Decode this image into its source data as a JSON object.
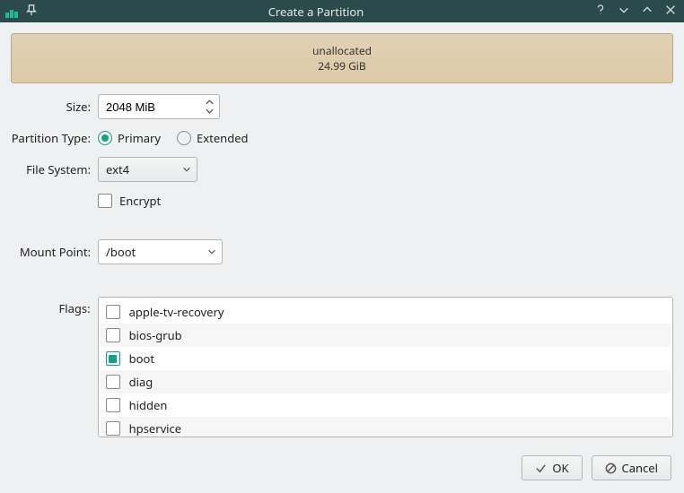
{
  "window": {
    "title": "Create a Partition"
  },
  "partition_bar": {
    "name": "unallocated",
    "size": "24.99 GiB"
  },
  "form": {
    "size": {
      "label": "Size:",
      "value": "2048 MiB"
    },
    "partition_type": {
      "label": "Partition Type:",
      "primary": "Primary",
      "extended": "Extended",
      "selected": "primary"
    },
    "filesystem": {
      "label": "File System:",
      "value": "ext4"
    },
    "encrypt": {
      "label": "Encrypt",
      "checked": false
    },
    "mount_point": {
      "label": "Mount Point:",
      "value": "/boot"
    },
    "flags": {
      "label": "Flags:",
      "items": [
        {
          "label": "apple-tv-recovery",
          "checked": false
        },
        {
          "label": "bios-grub",
          "checked": false
        },
        {
          "label": "boot",
          "checked": true
        },
        {
          "label": "diag",
          "checked": false
        },
        {
          "label": "hidden",
          "checked": false
        },
        {
          "label": "hpservice",
          "checked": false
        }
      ]
    }
  },
  "buttons": {
    "ok": "OK",
    "cancel": "Cancel"
  }
}
